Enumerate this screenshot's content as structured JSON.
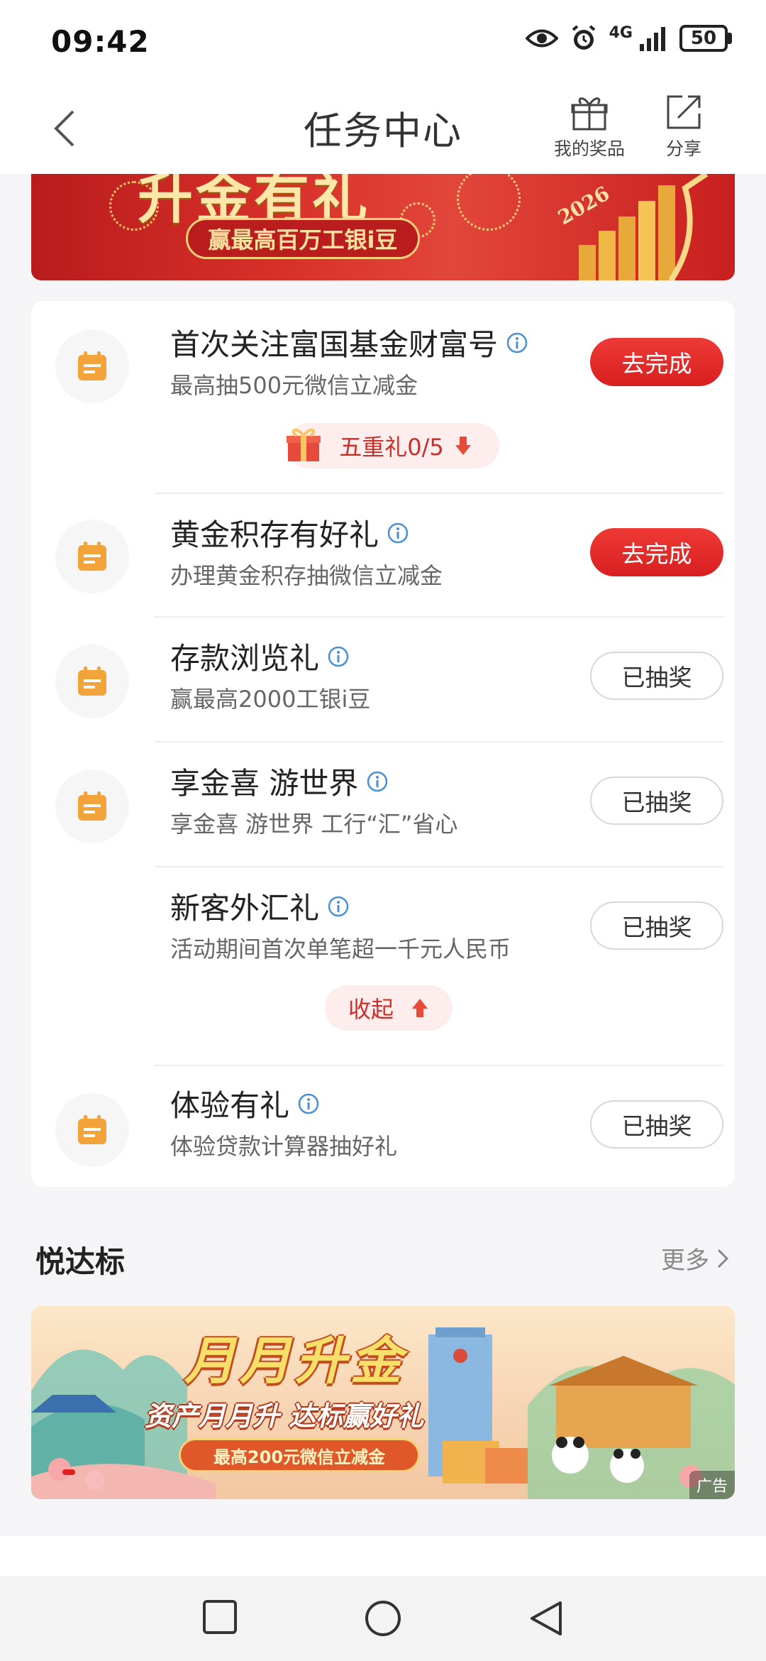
{
  "status_bar": {
    "time": "09:42",
    "network": "4G",
    "battery": "50"
  },
  "header": {
    "title": "任务中心",
    "prize_label": "我的奖品",
    "share_label": "分享"
  },
  "top_banner": {
    "title": "升金有礼",
    "subtitle": "赢最高百万工银i豆",
    "year": "2026"
  },
  "tasks": [
    {
      "title": "首次关注富国基金财富号",
      "subtitle": "最高抽500元微信立减金",
      "button": "去完成",
      "state": "todo"
    },
    {
      "title": "黄金积存有好礼",
      "subtitle": "办理黄金积存抽微信立减金",
      "button": "去完成",
      "state": "todo"
    },
    {
      "title": "存款浏览礼",
      "subtitle": "赢最高2000工银i豆",
      "button": "已抽奖",
      "state": "done"
    },
    {
      "title": "享金喜 游世界",
      "subtitle": "享金喜 游世界 工行“汇”省心",
      "button": "已抽奖",
      "state": "done"
    },
    {
      "title": "新客外汇礼",
      "subtitle": "活动期间首次单笔超一千元人民币",
      "button": "已抽奖",
      "state": "done"
    },
    {
      "title": "体验有礼",
      "subtitle": "体验贷款计算器抽好礼",
      "button": "已抽奖",
      "state": "done"
    }
  ],
  "five_gifts": {
    "label": "五重礼0/5"
  },
  "collapse": {
    "label": "收起"
  },
  "section": {
    "title": "悦达标",
    "more": "更多"
  },
  "ad_banner": {
    "title": "月月升金",
    "subtitle": "资产月月升 达标赢好礼",
    "note": "最高200元微信立减金",
    "tag": "广告"
  },
  "colors": {
    "accent_red": "#e02b2b",
    "icon_orange": "#f2a33a",
    "info_blue": "#4a90d9"
  }
}
